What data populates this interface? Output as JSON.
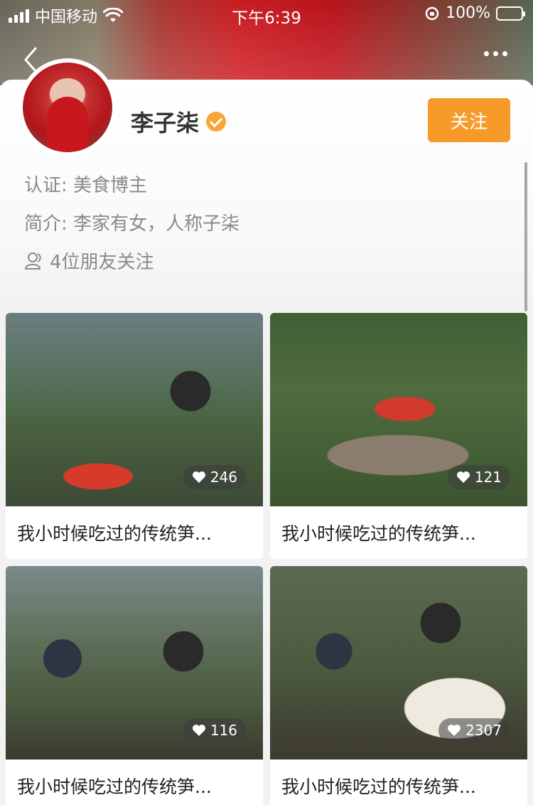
{
  "status_bar": {
    "carrier": "中国移动",
    "time": "下午6:39",
    "battery": "100%"
  },
  "icons": {
    "back": "chevron-left-icon",
    "more": "more-icon",
    "verified": "verified-badge-icon",
    "friends": "person-icon",
    "likes": "heart-icon"
  },
  "colors": {
    "accent": "#f89a2a",
    "verified": "#f7a63a",
    "battery": "#4cd964"
  },
  "profile": {
    "name": "李子柒",
    "follow_label": "关注",
    "certification": "认证: 美食博主",
    "bio": "简介: 李家有女，人称子柒",
    "friends_following": "4位朋友关注"
  },
  "videos": [
    {
      "caption": "我小时候吃过的传统笋...",
      "likes": "246"
    },
    {
      "caption": "我小时候吃过的传统笋...",
      "likes": "121"
    },
    {
      "caption": "我小时候吃过的传统笋...",
      "likes": "116"
    },
    {
      "caption": "我小时候吃过的传统笋...",
      "likes": "2307"
    }
  ]
}
